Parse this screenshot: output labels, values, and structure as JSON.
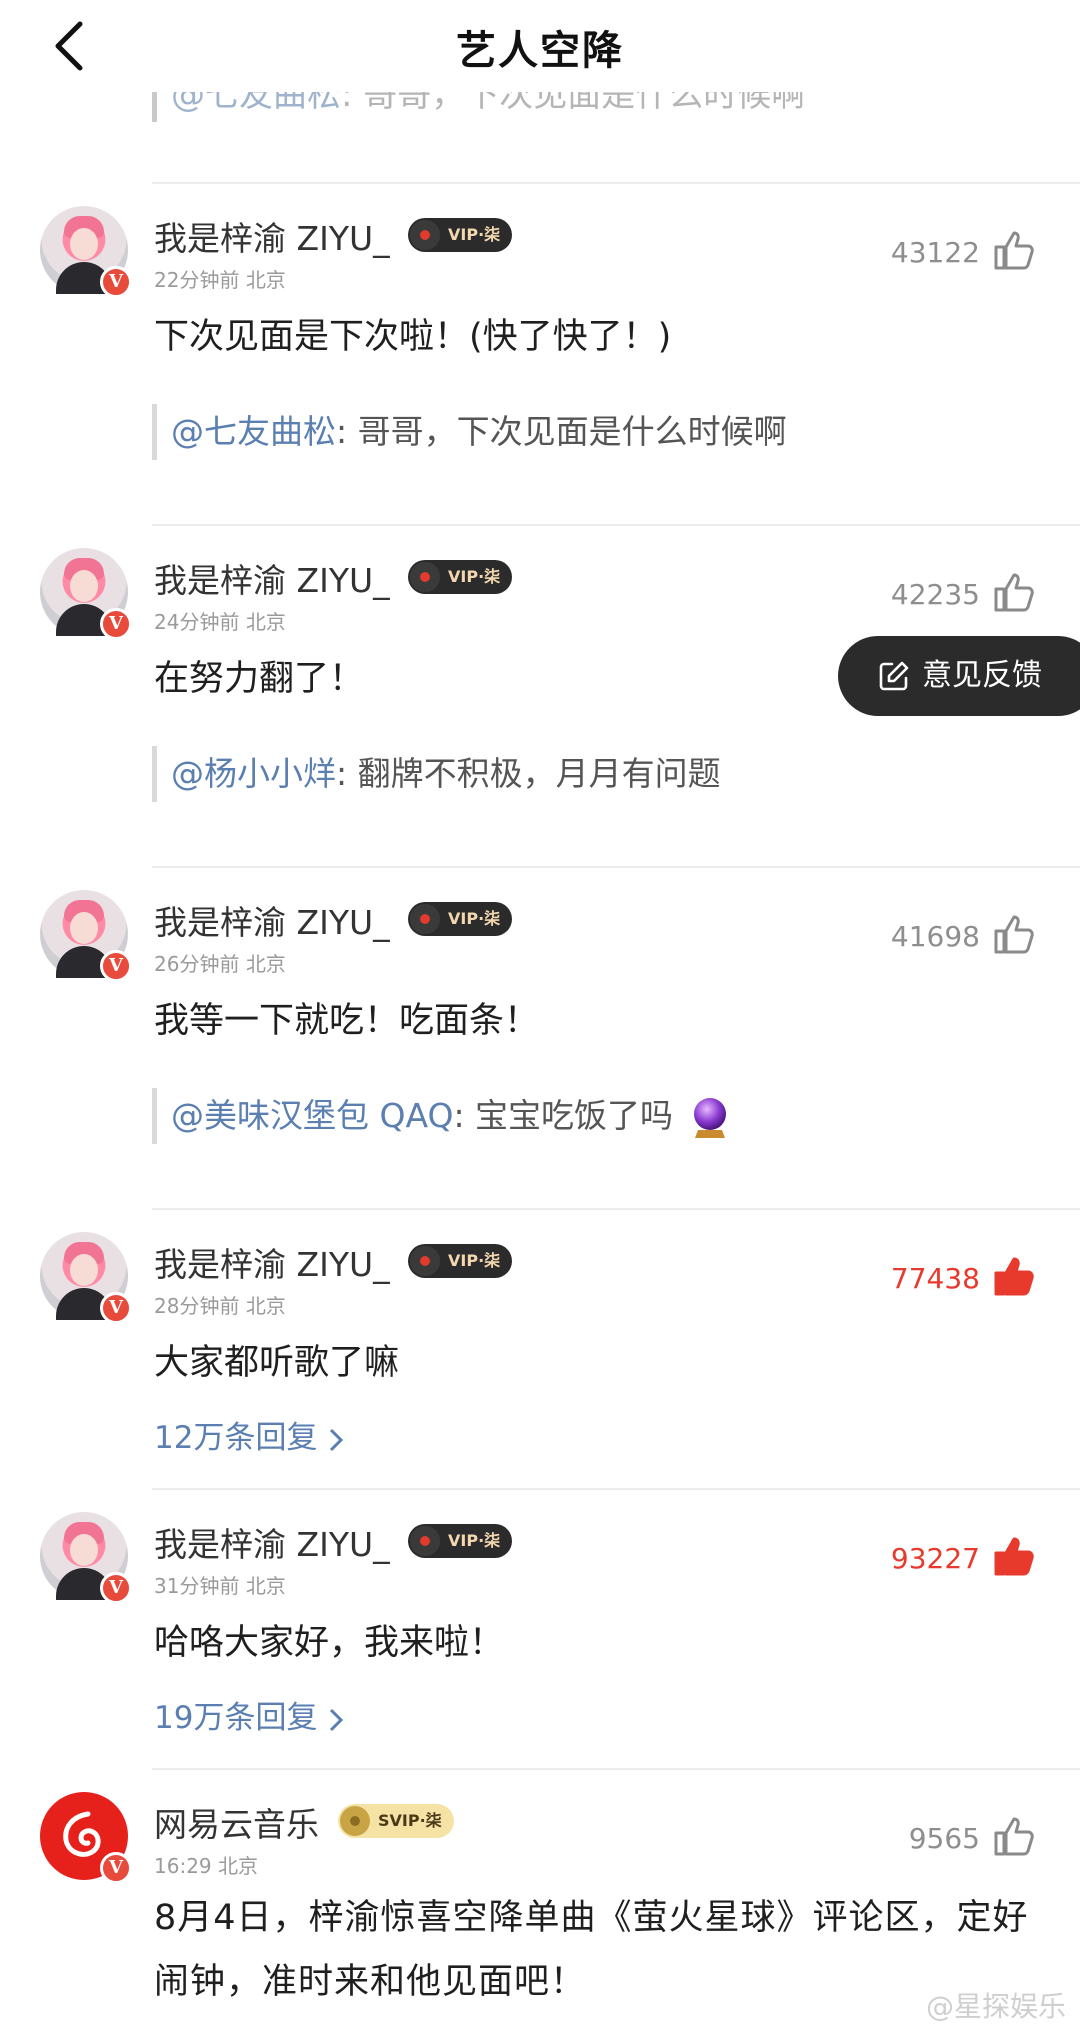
{
  "header": {
    "title": "艺人空降"
  },
  "cut_reply": {
    "mention": "@七友曲松",
    "text": ": 哥哥，下次见面是什么时候啊"
  },
  "colors": {
    "accent_red": "#e8392d",
    "mention_blue": "#5a7fb0",
    "like_gray": "#8e8e8e"
  },
  "comments": [
    {
      "username": "我是梓渝 ZIYU_",
      "badge": "VIP·柒",
      "time": "22分钟前",
      "location": "北京",
      "likes": "43122",
      "liked": false,
      "text": "下次见面是下次啦！(快了快了！)",
      "reply_mention": "@七友曲松",
      "reply_text": ": 哥哥，下次见面是什么时候啊"
    },
    {
      "username": "我是梓渝 ZIYU_",
      "badge": "VIP·柒",
      "time": "24分钟前",
      "location": "北京",
      "likes": "42235",
      "liked": false,
      "text": "在努力翻了！",
      "reply_mention": "@杨小小烊",
      "reply_text": ": 翻牌不积极，月月有问题"
    },
    {
      "username": "我是梓渝 ZIYU_",
      "badge": "VIP·柒",
      "time": "26分钟前",
      "location": "北京",
      "likes": "41698",
      "liked": false,
      "text": "我等一下就吃！吃面条！",
      "reply_mention": "@美味汉堡包 QAQ",
      "reply_text": ": 宝宝吃饭了吗"
    },
    {
      "username": "我是梓渝 ZIYU_",
      "badge": "VIP·柒",
      "time": "28分钟前",
      "location": "北京",
      "likes": "77438",
      "liked": true,
      "text": "大家都听歌了嘛",
      "more_replies": "12万条回复"
    },
    {
      "username": "我是梓渝 ZIYU_",
      "badge": "VIP·柒",
      "time": "31分钟前",
      "location": "北京",
      "likes": "93227",
      "liked": true,
      "text": "哈咯大家好，我来啦！",
      "more_replies": "19万条回复"
    },
    {
      "username": "网易云音乐",
      "badge": "SVIP·柒",
      "time": "16:29",
      "location": "北京",
      "likes": "9565",
      "liked": false,
      "text": "8月4日，梓渝惊喜空降单曲《萤火星球》评论区，定好闹钟，准时来和他见面吧！"
    }
  ],
  "feedback": {
    "label": "意见反馈"
  },
  "watermark": "@星探娱乐",
  "icons": {
    "back": "chevron-left-icon",
    "thumb": "thumbs-up-icon",
    "verified": "v-badge-icon",
    "vinyl": "vinyl-disc-icon",
    "edit": "edit-icon",
    "crystal_ball": "crystal-ball-icon",
    "chevron_right": "chevron-right-icon"
  }
}
